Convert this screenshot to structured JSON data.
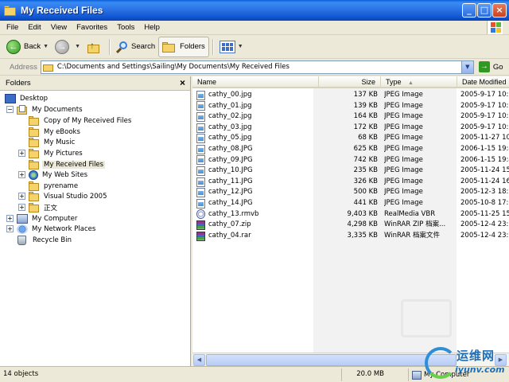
{
  "window": {
    "title": "My Received Files",
    "controls": [
      "_",
      "□",
      "×"
    ]
  },
  "menu": [
    "File",
    "Edit",
    "View",
    "Favorites",
    "Tools",
    "Help"
  ],
  "toolbar": {
    "back_label": "Back",
    "search_label": "Search",
    "folders_label": "Folders"
  },
  "address": {
    "label": "Address",
    "value": "C:\\Documents and Settings\\Sailing\\My Documents\\My Received Files",
    "go_label": "Go"
  },
  "folders_pane": {
    "title": "Folders",
    "close": "×",
    "tree": [
      {
        "label": "Desktop",
        "icon": "desktop-icon",
        "expander": ""
      },
      {
        "label": "My Documents",
        "icon": "my-documents-icon",
        "expander": "−"
      },
      {
        "label": "Copy of My Received Files",
        "icon": "folder-icon",
        "expander": ""
      },
      {
        "label": "My eBooks",
        "icon": "folder-icon",
        "expander": ""
      },
      {
        "label": "My Music",
        "icon": "folder-icon",
        "expander": ""
      },
      {
        "label": "My Pictures",
        "icon": "folder-icon",
        "expander": "+"
      },
      {
        "label": "My Received Files",
        "icon": "folder-icon",
        "expander": "",
        "selected": true
      },
      {
        "label": "My Web Sites",
        "icon": "web-sites-icon",
        "expander": "+"
      },
      {
        "label": "pyrename",
        "icon": "folder-icon",
        "expander": ""
      },
      {
        "label": "Visual Studio 2005",
        "icon": "folder-icon",
        "expander": "+"
      },
      {
        "label": "正文",
        "icon": "folder-icon",
        "expander": "+"
      },
      {
        "label": "My Computer",
        "icon": "my-computer-icon",
        "expander": "+"
      },
      {
        "label": "My Network Places",
        "icon": "network-places-icon",
        "expander": "+"
      },
      {
        "label": "Recycle Bin",
        "icon": "recycle-bin-icon",
        "expander": ""
      }
    ]
  },
  "file_list": {
    "columns": {
      "name": "Name",
      "size": "Size",
      "type": "Type",
      "date": "Date Modified"
    },
    "sort_column": "Type",
    "files": [
      {
        "name": "cathy_00.jpg",
        "size": "137 KB",
        "type": "JPEG Image",
        "date": "2005-9-17 10:0",
        "icon": "jpg"
      },
      {
        "name": "cathy_01.jpg",
        "size": "139 KB",
        "type": "JPEG Image",
        "date": "2005-9-17 10:0",
        "icon": "jpg"
      },
      {
        "name": "cathy_02.jpg",
        "size": "164 KB",
        "type": "JPEG Image",
        "date": "2005-9-17 10:1",
        "icon": "jpg"
      },
      {
        "name": "cathy_03.jpg",
        "size": "172 KB",
        "type": "JPEG Image",
        "date": "2005-9-17 10:0",
        "icon": "jpg"
      },
      {
        "name": "cathy_05.jpg",
        "size": "68 KB",
        "type": "JPEG Image",
        "date": "2005-11-27 10",
        "icon": "jpg"
      },
      {
        "name": "cathy_08.JPG",
        "size": "625 KB",
        "type": "JPEG Image",
        "date": "2006-1-15 19:4",
        "icon": "jpg"
      },
      {
        "name": "cathy_09.JPG",
        "size": "742 KB",
        "type": "JPEG Image",
        "date": "2006-1-15 19:4",
        "icon": "jpg"
      },
      {
        "name": "cathy_10.JPG",
        "size": "235 KB",
        "type": "JPEG Image",
        "date": "2005-11-24 15",
        "icon": "jpg"
      },
      {
        "name": "cathy_11.JPG",
        "size": "326 KB",
        "type": "JPEG Image",
        "date": "2005-11-24 16",
        "icon": "jpg"
      },
      {
        "name": "cathy_12.JPG",
        "size": "500 KB",
        "type": "JPEG Image",
        "date": "2005-12-3 18:5",
        "icon": "jpg"
      },
      {
        "name": "cathy_14.JPG",
        "size": "441 KB",
        "type": "JPEG Image",
        "date": "2005-10-8 17:0",
        "icon": "jpg"
      },
      {
        "name": "cathy_13.rmvb",
        "size": "9,403 KB",
        "type": "RealMedia VBR",
        "date": "2005-11-25 15",
        "icon": "rmvb"
      },
      {
        "name": "cathy_07.zip",
        "size": "4,298 KB",
        "type": "WinRAR ZIP 档案...",
        "date": "2005-12-4 23:1",
        "icon": "rar"
      },
      {
        "name": "cathy_04.rar",
        "size": "3,335 KB",
        "type": "WinRAR 档案文件",
        "date": "2005-12-4 23:1",
        "icon": "rar"
      }
    ]
  },
  "status": {
    "objects": "14 objects",
    "total_size": "20.0 MB",
    "location": "My Computer"
  },
  "watermark": {
    "text_cn": "运维网",
    "url": "iyunv.com"
  },
  "colors": {
    "titlebar": "#2B73E6",
    "chrome": "#ECE9D8",
    "selection": "#ECE9D8"
  }
}
